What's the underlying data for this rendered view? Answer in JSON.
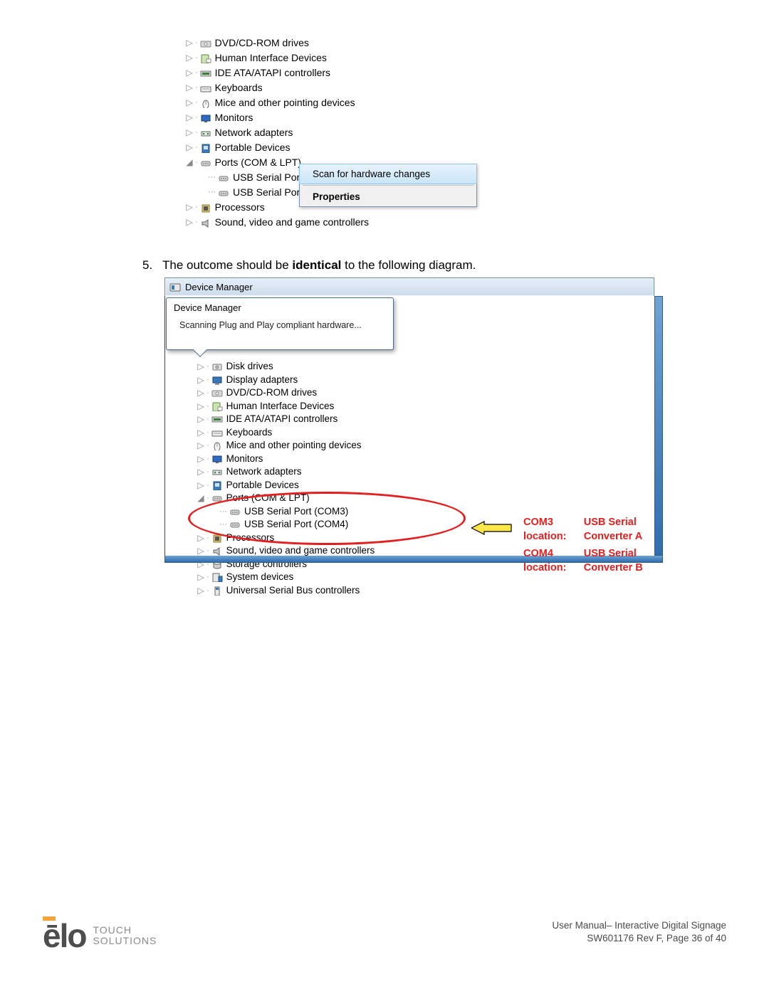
{
  "tree1": {
    "items": [
      {
        "label": "DVD/CD-ROM drives",
        "icon": "disc"
      },
      {
        "label": "Human Interface Devices",
        "icon": "hid"
      },
      {
        "label": "IDE ATA/ATAPI controllers",
        "icon": "ide"
      },
      {
        "label": "Keyboards",
        "icon": "kbd"
      },
      {
        "label": "Mice and other pointing devices",
        "icon": "mouse"
      },
      {
        "label": "Monitors",
        "icon": "monitor"
      },
      {
        "label": "Network adapters",
        "icon": "net"
      },
      {
        "label": "Portable Devices",
        "icon": "port"
      }
    ],
    "ports_label": "Ports (COM & LPT)",
    "ports_children": [
      {
        "label": "USB Serial Port"
      },
      {
        "label": "USB Serial Port"
      }
    ],
    "after": [
      {
        "label": "Processors",
        "icon": "cpu"
      },
      {
        "label": "Sound, video and game controllers",
        "icon": "sound"
      }
    ]
  },
  "context_menu": {
    "scan": "Scan for hardware changes",
    "properties": "Properties"
  },
  "step": {
    "number": "5.",
    "text_a": "The outcome should be ",
    "bold": "identical",
    "text_b": " to the following diagram."
  },
  "shot2": {
    "title": "Device Manager",
    "tooltip_label": "Device Manager",
    "tooltip_msg": "Scanning Plug and Play compliant hardware...",
    "items": [
      {
        "label": "Disk drives",
        "icon": "disk"
      },
      {
        "label": "Display adapters",
        "icon": "disp"
      },
      {
        "label": "DVD/CD-ROM drives",
        "icon": "disc"
      },
      {
        "label": "Human Interface Devices",
        "icon": "hid"
      },
      {
        "label": "IDE ATA/ATAPI controllers",
        "icon": "ide"
      },
      {
        "label": "Keyboards",
        "icon": "kbd"
      },
      {
        "label": "Mice and other pointing devices",
        "icon": "mouse"
      },
      {
        "label": "Monitors",
        "icon": "monitor"
      },
      {
        "label": "Network adapters",
        "icon": "net"
      },
      {
        "label": "Portable Devices",
        "icon": "port"
      }
    ],
    "ports_label": "Ports (COM & LPT)",
    "ports_children": [
      {
        "label": "USB Serial Port (COM3)"
      },
      {
        "label": "USB Serial Port (COM4)"
      }
    ],
    "after": [
      {
        "label": "Processors",
        "icon": "cpu"
      },
      {
        "label": "Sound, video and game controllers",
        "icon": "sound"
      },
      {
        "label": "Storage controllers",
        "icon": "stor"
      },
      {
        "label": "System devices",
        "icon": "sys"
      },
      {
        "label": "Universal Serial Bus controllers",
        "icon": "usb"
      }
    ]
  },
  "red": {
    "l1a": "COM3 location:",
    "l1b": "USB Serial Converter A",
    "l2a": "COM4 location:",
    "l2b": "USB Serial Converter B"
  },
  "footer": {
    "brand": "ēlo",
    "sub1": "TOUCH",
    "sub2": "SOLUTIONS",
    "line1": "User Manual– Interactive Digital Signage",
    "line2": "SW601176  Rev  F,  Page  36  of  40"
  }
}
